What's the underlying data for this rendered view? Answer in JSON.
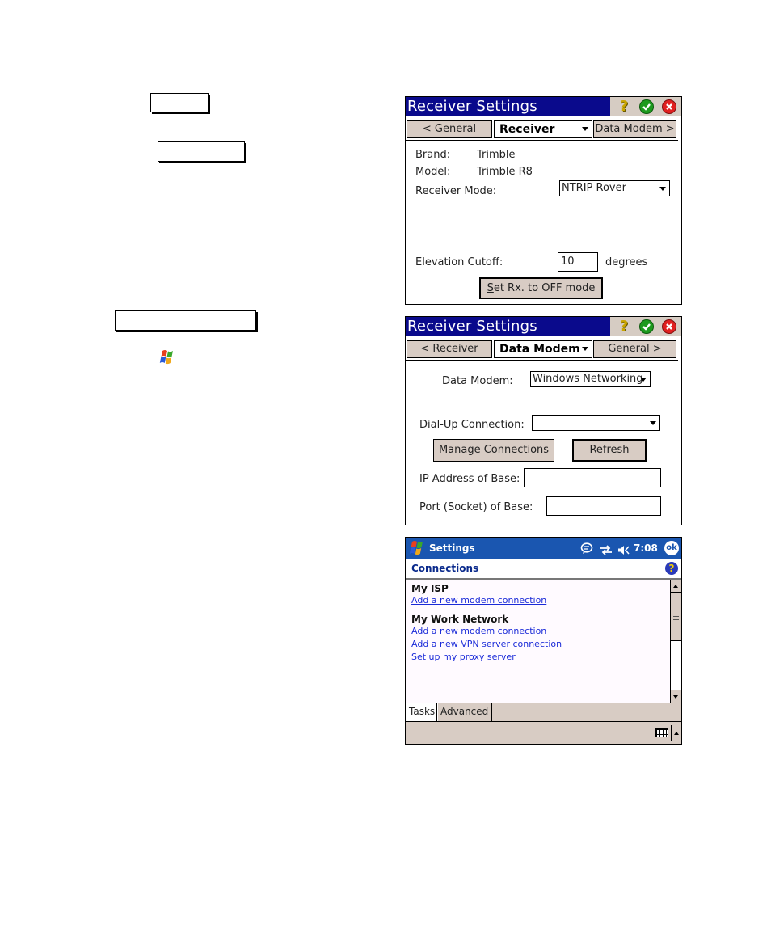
{
  "left_callouts": {
    "icons": {
      "windows_flag": "windows-start-flag"
    }
  },
  "receiver_panel": {
    "title": "Receiver Settings",
    "titlebar_icons": [
      "help-icon",
      "ok-check-icon",
      "close-x-icon"
    ],
    "help_glyph": "?",
    "nav_prev": "< General",
    "tab_selected": "Receiver",
    "nav_next": "Data Modem >",
    "brand_label": "Brand:",
    "brand_value": "Trimble",
    "model_label": "Model:",
    "model_value": "Trimble R8",
    "mode_label": "Receiver Mode:",
    "mode_value": "NTRIP Rover",
    "elevation_label": "Elevation Cutoff:",
    "elevation_value": "10",
    "elevation_unit": "degrees",
    "set_off_button_accel": "S",
    "set_off_button_rest": "et Rx. to OFF mode"
  },
  "modem_panel": {
    "title": "Receiver Settings",
    "help_glyph": "?",
    "nav_prev": "< Receiver",
    "tab_selected": "Data Modem",
    "nav_next": "General >",
    "data_modem_label": "Data Modem:",
    "data_modem_value": "Windows Networking",
    "dialup_label": "Dial-Up Connection:",
    "dialup_value": "",
    "manage_button": "Manage Connections",
    "refresh_button": "Refresh",
    "ip_label": "IP Address of Base:",
    "ip_value": "",
    "port_label": "Port (Socket) of Base:",
    "port_value": ""
  },
  "settings_panel": {
    "app_title": "Settings",
    "time": "7:08",
    "ok_label": "ok",
    "status_icons": [
      "notification-bubble-icon",
      "connectivity-arrows-icon",
      "speaker-icon"
    ],
    "page_title": "Connections",
    "help_glyph": "?",
    "groups": [
      {
        "heading": "My ISP",
        "links": [
          "Add a new modem connection"
        ]
      },
      {
        "heading": "My Work Network",
        "links": [
          "Add a new modem connection",
          "Add a new VPN server connection",
          "Set up my proxy server"
        ]
      }
    ],
    "tabs": [
      "Tasks",
      "Advanced"
    ],
    "active_tab": "Tasks"
  }
}
